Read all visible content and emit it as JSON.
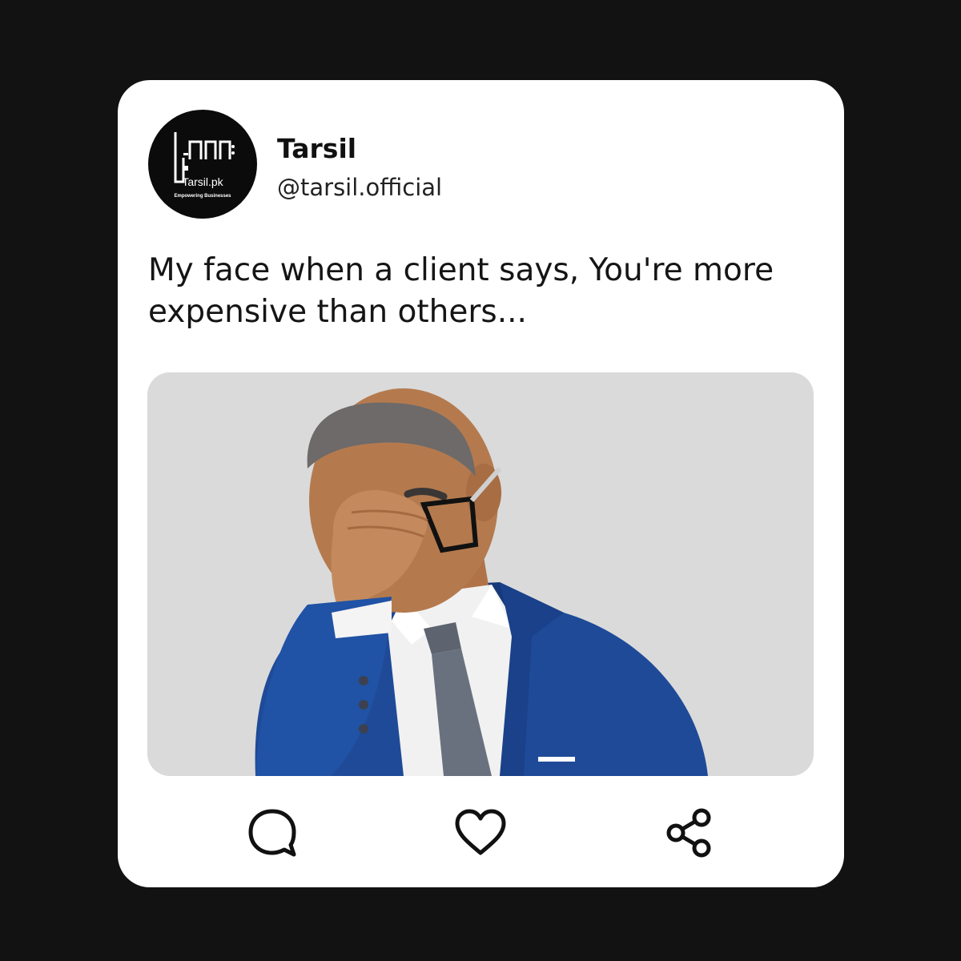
{
  "post": {
    "avatar": {
      "brand_name": "Tarsil.pk",
      "tagline": "Empowering Businesses"
    },
    "author_name": "Tarsil",
    "author_handle": "@tarsil.official",
    "text": "My face when a client says, You're more expensive than others...",
    "media": {
      "subject": "3d-businessman-facepalm",
      "background_color": "#dadada",
      "suit_color": "#1f4a98"
    }
  },
  "actions": [
    {
      "name": "comment",
      "icon": "speech-bubble-icon"
    },
    {
      "name": "like",
      "icon": "heart-icon"
    },
    {
      "name": "share",
      "icon": "share-nodes-icon"
    }
  ],
  "colors": {
    "page_background": "#131212",
    "card_background": "#ffffff",
    "text": "#151515"
  }
}
